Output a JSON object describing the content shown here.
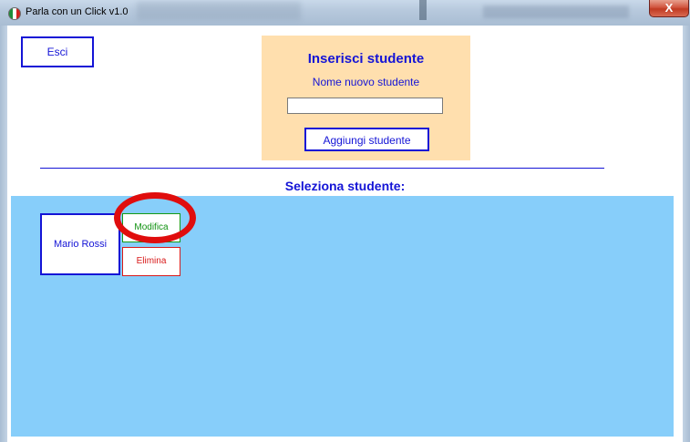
{
  "window": {
    "title": "Parla con un Click v1.0",
    "close_glyph": "X",
    "icon": "italy-flag-icon"
  },
  "header": {
    "exit_label": "Esci"
  },
  "insert_panel": {
    "title": "Inserisci studente",
    "field_label": "Nome nuovo studente",
    "name_value": "",
    "add_label": "Aggiungi studente"
  },
  "students": {
    "heading": "Seleziona studente:",
    "items": [
      {
        "name": "Mario Rossi",
        "edit_label": "Modifica",
        "delete_label": "Elimina"
      }
    ]
  },
  "colors": {
    "accent_blue": "#1414d6",
    "panel_orange": "#ffdfae",
    "students_bg": "#87cefa",
    "edit_green": "#119211",
    "delete_red": "#d81a1a",
    "highlight_red": "#e00d0d"
  }
}
